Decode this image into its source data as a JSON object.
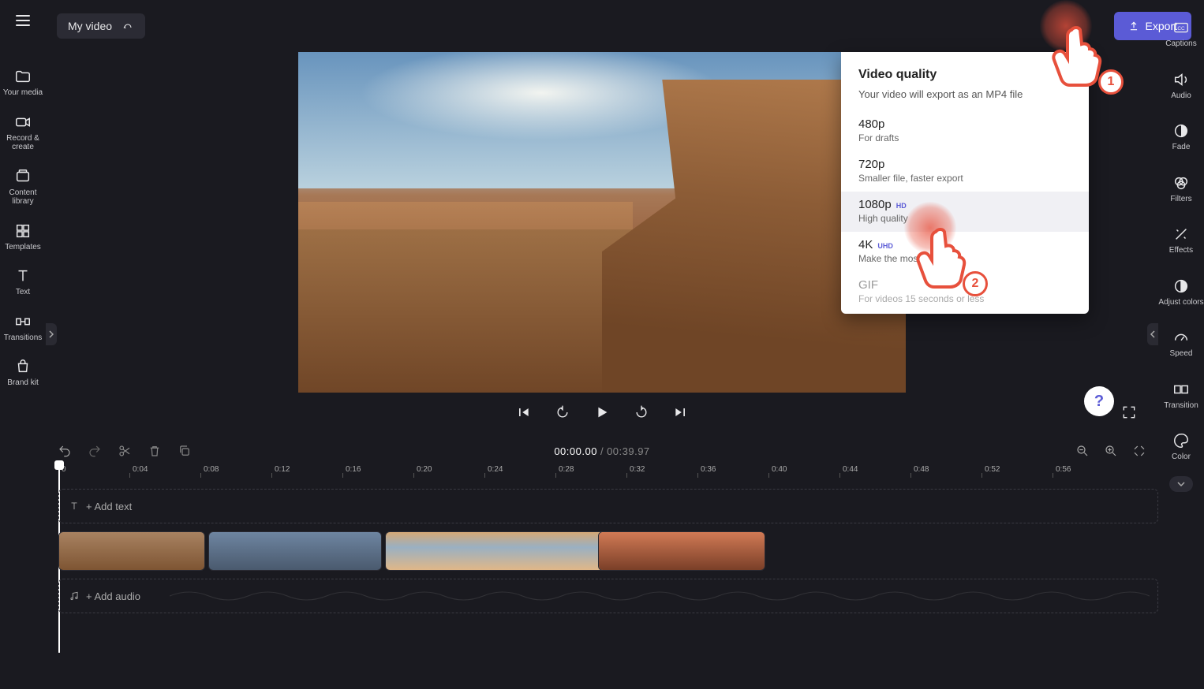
{
  "header": {
    "title": "My video",
    "export_label": "Export"
  },
  "left_rail": {
    "items": [
      {
        "label": "Your media"
      },
      {
        "label": "Record & create"
      },
      {
        "label": "Content library"
      },
      {
        "label": "Templates"
      },
      {
        "label": "Text"
      },
      {
        "label": "Transitions"
      },
      {
        "label": "Brand kit"
      }
    ]
  },
  "right_rail": {
    "items": [
      {
        "label": "Captions"
      },
      {
        "label": "Audio"
      },
      {
        "label": "Fade"
      },
      {
        "label": "Filters"
      },
      {
        "label": "Effects"
      },
      {
        "label": "Adjust colors"
      },
      {
        "label": "Speed"
      },
      {
        "label": "Transition"
      },
      {
        "label": "Color"
      }
    ]
  },
  "export_panel": {
    "title": "Video quality",
    "subtitle": "Your video will export as an MP4 file",
    "options": [
      {
        "title": "480p",
        "badge": "",
        "desc": "For drafts"
      },
      {
        "title": "720p",
        "badge": "",
        "desc": "Smaller file, faster export"
      },
      {
        "title": "1080p",
        "badge": "HD",
        "desc": "High quality"
      },
      {
        "title": "4K",
        "badge": "UHD",
        "desc": "Make the most of"
      },
      {
        "title": "GIF",
        "badge": "",
        "desc": "For videos 15 seconds or less"
      }
    ]
  },
  "timeline": {
    "current": "00:00.00",
    "total": "00:39.97",
    "ticks": [
      "0",
      "0:04",
      "0:08",
      "0:12",
      "0:16",
      "0:20",
      "0:24",
      "0:28",
      "0:32",
      "0:36",
      "0:40",
      "0:44",
      "0:48",
      "0:52",
      "0:56"
    ],
    "add_text_label": "+ Add text",
    "add_audio_label": "+ Add audio"
  },
  "annotations": {
    "step1": "1",
    "step2": "2"
  },
  "help_label": "?"
}
